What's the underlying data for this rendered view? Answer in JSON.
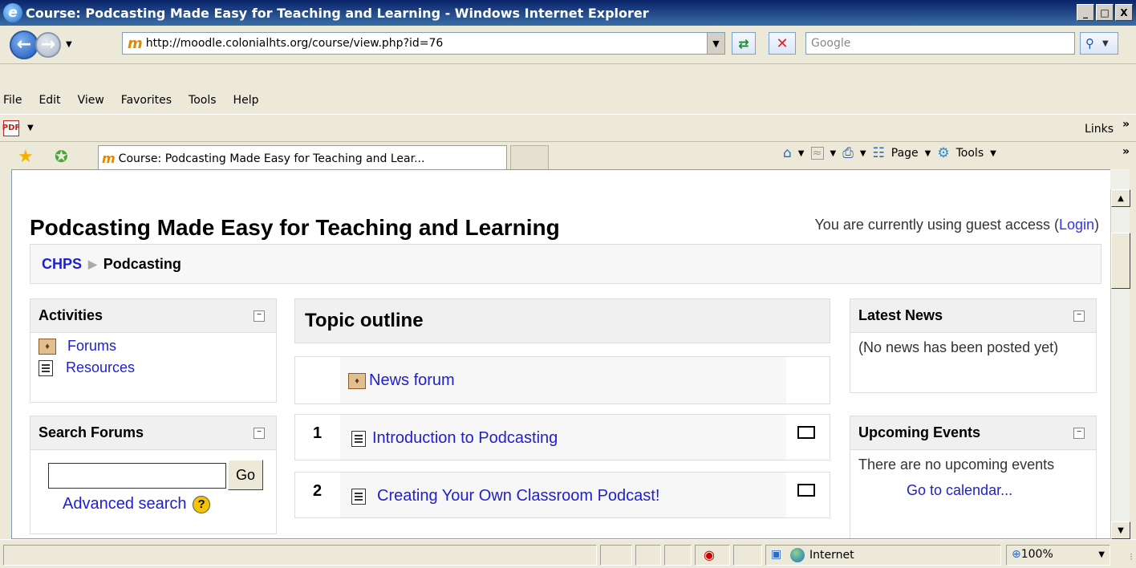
{
  "window": {
    "title": "Course: Podcasting Made Easy for Teaching and Learning - Windows Internet Explorer",
    "controls": [
      "_",
      "□",
      "X"
    ]
  },
  "address": {
    "url": "http://moodle.colonialhts.org/course/view.php?id=76",
    "search_placeholder": "Google"
  },
  "menu": {
    "items": [
      "File",
      "Edit",
      "View",
      "Favorites",
      "Tools",
      "Help"
    ]
  },
  "toolbar2": {
    "links_label": "Links"
  },
  "tabs": {
    "active_label": "Course: Podcasting Made Easy for Teaching and Lear..."
  },
  "commandbar": {
    "page_label": "Page",
    "tools_label": "Tools"
  },
  "page": {
    "course_title": "Podcasting Made Easy for Teaching and Learning",
    "guest_text": "You are currently using guest access (",
    "login_link": "Login",
    "guest_close": ")",
    "breadcrumb": {
      "root": "CHPS",
      "current": "Podcasting"
    }
  },
  "activities": {
    "title": "Activities",
    "items": [
      "Forums",
      "Resources"
    ]
  },
  "search_forums": {
    "title": "Search Forums",
    "go_label": "Go",
    "advanced_label": "Advanced search"
  },
  "topics": {
    "title": "Topic outline",
    "news_forum": "News forum",
    "sections": [
      {
        "number": "1",
        "label": "Introduction to Podcasting"
      },
      {
        "number": "2",
        "label": "Creating Your Own Classroom Podcast!"
      }
    ]
  },
  "latest_news": {
    "title": "Latest News",
    "body": "(No news has been posted yet)"
  },
  "upcoming_events": {
    "title": "Upcoming Events",
    "body": "There are no upcoming events",
    "calendar_link": "Go to calendar..."
  },
  "status": {
    "zone": "Internet",
    "zoom": "100%"
  },
  "colors": {
    "link": "#2020d0",
    "titlebar": "#0a246a",
    "block_header": "#f0f0f0"
  }
}
